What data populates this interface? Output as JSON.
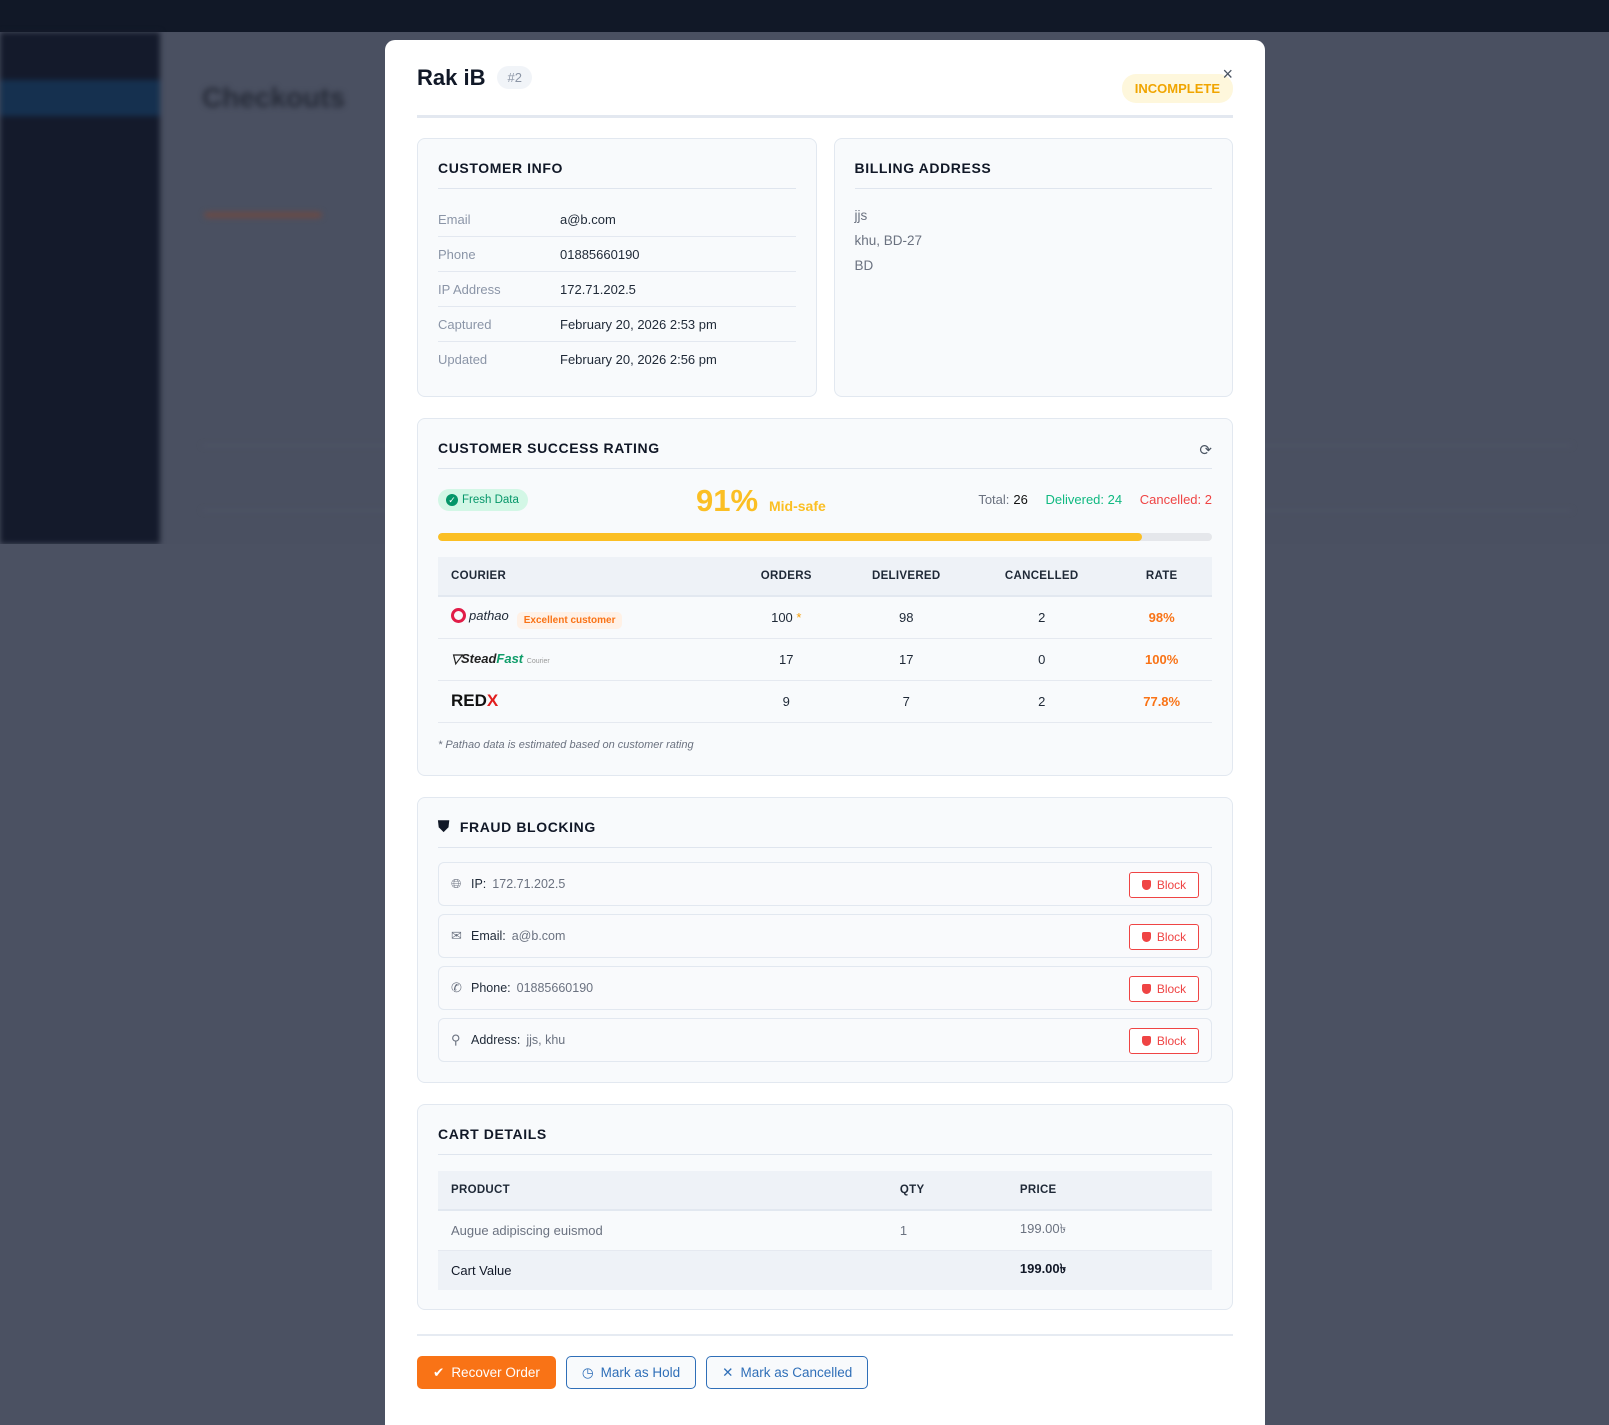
{
  "background": {
    "page_title": "Checkouts"
  },
  "modal": {
    "title": "Rak iB",
    "id_badge": "#2",
    "status": "INCOMPLETE",
    "close": "×",
    "customer_info": {
      "heading": "CUSTOMER INFO",
      "rows": [
        {
          "label": "Email",
          "value": "a@b.com"
        },
        {
          "label": "Phone",
          "value": "01885660190"
        },
        {
          "label": "IP Address",
          "value": "172.71.202.5"
        },
        {
          "label": "Captured",
          "value": "February 20, 2026 2:53 pm"
        },
        {
          "label": "Updated",
          "value": "February 20, 2026 2:56 pm"
        }
      ]
    },
    "billing_address": {
      "heading": "BILLING ADDRESS",
      "lines": [
        "jjs",
        "khu, BD-27",
        "BD"
      ]
    },
    "rating": {
      "heading": "CUSTOMER SUCCESS RATING",
      "fresh": "Fresh Data",
      "percent": "91%",
      "percent_value": 91,
      "label": "Mid-safe",
      "total_label": "Total:",
      "total": "26",
      "delivered": "Delivered: 24",
      "cancelled": "Cancelled: 2",
      "columns": [
        "COURIER",
        "ORDERS",
        "DELIVERED",
        "CANCELLED",
        "RATE"
      ],
      "couriers": [
        {
          "name": "pathao",
          "badge": "Excellent customer",
          "orders": "100",
          "star": "*",
          "delivered": "98",
          "cancelled": "2",
          "rate": "98%"
        },
        {
          "name": "SteadFast",
          "name_b": "Fast",
          "sub": "Courier",
          "orders": "17",
          "delivered": "17",
          "cancelled": "0",
          "rate": "100%"
        },
        {
          "name": "RED",
          "name_b": "X",
          "orders": "9",
          "delivered": "7",
          "cancelled": "2",
          "rate": "77.8%"
        }
      ],
      "note": "* Pathao data is estimated based on customer rating"
    },
    "fraud": {
      "heading": "FRAUD BLOCKING",
      "block": "Block",
      "rows": [
        {
          "label": "IP:",
          "value": "172.71.202.5",
          "icon": "globe-icon"
        },
        {
          "label": "Email:",
          "value": "a@b.com",
          "icon": "mail-icon"
        },
        {
          "label": "Phone:",
          "value": "01885660190",
          "icon": "phone-icon"
        },
        {
          "label": "Address:",
          "value": "jjs, khu",
          "icon": "pin-icon"
        }
      ]
    },
    "cart": {
      "heading": "CART DETAILS",
      "columns": [
        "PRODUCT",
        "QTY",
        "PRICE"
      ],
      "items": [
        {
          "product": "Augue adipiscing euismod",
          "qty": "1",
          "price": "199.00৳"
        }
      ],
      "total_label": "Cart Value",
      "total": "199.00৳"
    },
    "actions": {
      "recover": "Recover Order",
      "hold": "Mark as Hold",
      "cancel": "Mark as Cancelled"
    }
  }
}
